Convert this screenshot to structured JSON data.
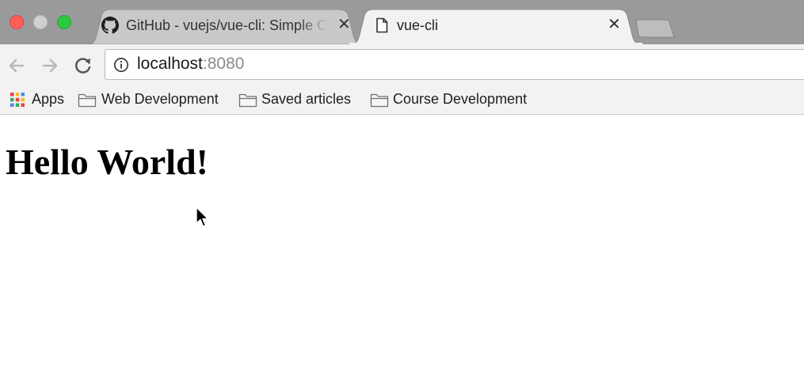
{
  "window": {
    "controls": [
      "close",
      "minimize",
      "maximize"
    ]
  },
  "tabs": [
    {
      "title": "GitHub - vuejs/vue-cli: Simple CLI for scaffolding Vue.js projects",
      "favicon": "github-icon",
      "close": "✕",
      "active": false
    },
    {
      "title": "vue-cli",
      "favicon": "page-icon",
      "close": "✕",
      "active": true
    }
  ],
  "toolbar": {
    "back_icon": "arrow-left-icon",
    "forward_icon": "arrow-right-icon",
    "reload_icon": "reload-icon",
    "address": {
      "host": "localhost",
      "port": ":8080",
      "security_icon": "info-icon"
    }
  },
  "bookmarks": [
    {
      "label": "Apps",
      "icon": "apps-grid-icon"
    },
    {
      "label": "Web Development",
      "icon": "folder-icon"
    },
    {
      "label": "Saved articles",
      "icon": "folder-icon"
    },
    {
      "label": "Course Development",
      "icon": "folder-icon"
    }
  ],
  "page": {
    "heading": "Hello World!"
  },
  "colors": {
    "tabstrip": "#9a9a9a",
    "toolbar": "#f2f2f2",
    "close": "#fc5f57",
    "minimize": "#cfcfcf",
    "maximize": "#2cc840"
  }
}
